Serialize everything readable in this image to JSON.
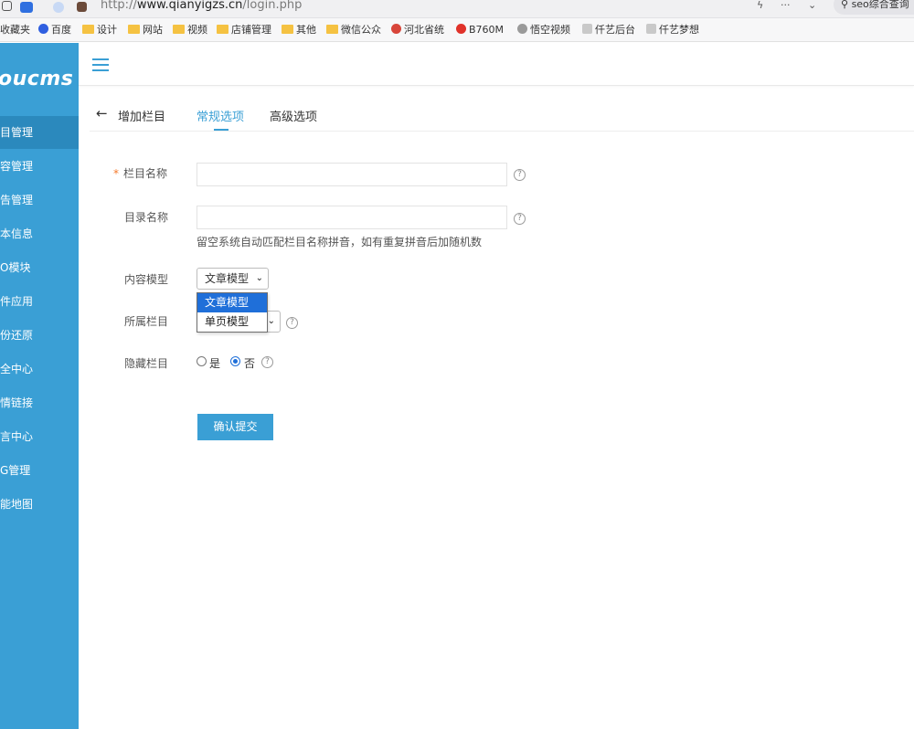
{
  "browser": {
    "url_prefix": "http://",
    "url_domain": "www.qianyigzs.cn",
    "url_path": "/login.php",
    "menu_dots": "···",
    "search_text": "seo综合查询"
  },
  "bookmarks": [
    {
      "label": "收藏夹"
    },
    {
      "label": "百度"
    },
    {
      "label": "设计"
    },
    {
      "label": "网站"
    },
    {
      "label": "视频"
    },
    {
      "label": "店铺管理"
    },
    {
      "label": "其他"
    },
    {
      "label": "微信公众"
    },
    {
      "label": "河北省统"
    },
    {
      "label": "B760M"
    },
    {
      "label": "悟空视频"
    },
    {
      "label": "仟艺后台"
    },
    {
      "label": "仟艺梦想"
    }
  ],
  "sidebar": {
    "logo": "oucms",
    "items": [
      {
        "label": "目管理"
      },
      {
        "label": "容管理"
      },
      {
        "label": "告管理"
      },
      {
        "label": "本信息"
      },
      {
        "label": "O模块"
      },
      {
        "label": "件应用"
      },
      {
        "label": "份还原"
      },
      {
        "label": "全中心"
      },
      {
        "label": "情链接"
      },
      {
        "label": "言中心"
      },
      {
        "label": "G管理"
      },
      {
        "label": "能地图"
      }
    ]
  },
  "header": {
    "back_arrow": "←",
    "title": "增加栏目",
    "tabs": [
      {
        "label": "常规选项"
      },
      {
        "label": "高级选项"
      }
    ]
  },
  "form": {
    "required_mark": "*",
    "column_name": {
      "label": "栏目名称",
      "value": ""
    },
    "dir_name": {
      "label": "目录名称",
      "value": "",
      "hint": "留空系统自动匹配栏目名称拼音，如有重复拼音后加随机数"
    },
    "content_model": {
      "label": "内容模型",
      "selected": "文章模型",
      "options": [
        "文章模型",
        "单页模型"
      ]
    },
    "parent_column": {
      "label": "所属栏目"
    },
    "hidden_column": {
      "label": "隐藏栏目",
      "options": [
        "是",
        "否"
      ],
      "selected": "否"
    },
    "help_glyph": "?",
    "chevron": "⌄",
    "submit_label": "确认提交"
  },
  "colors": {
    "accent": "#3a9fd5",
    "sidebar_active": "#2b89bd",
    "dropdown_selected": "#1f6fd9",
    "required": "#f5792a"
  }
}
